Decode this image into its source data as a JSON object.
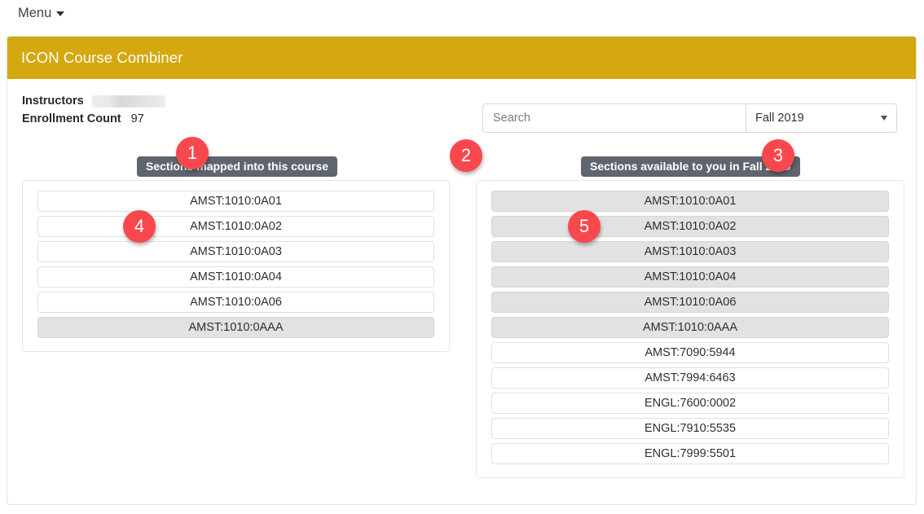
{
  "topbar": {
    "menu_label": "Menu",
    "caret_icon": "chevron-down-icon"
  },
  "card": {
    "header_title": "ICON Course Combiner"
  },
  "info": {
    "instructors_label": "Instructors",
    "instructors_value_redacted": "",
    "enrollment_label": "Enrollment Count",
    "enrollment_value": "97"
  },
  "search": {
    "placeholder": "Search",
    "value": ""
  },
  "term": {
    "selected": "Fall 2019",
    "options": [
      "Fall 2019"
    ],
    "caret_icon": "chevron-down-icon"
  },
  "panels": {
    "left": {
      "pill_label": "Sections mapped into this course",
      "items": [
        {
          "label": "AMST:1010:0A01",
          "state": "normal"
        },
        {
          "label": "AMST:1010:0A02",
          "state": "normal"
        },
        {
          "label": "AMST:1010:0A03",
          "state": "normal"
        },
        {
          "label": "AMST:1010:0A04",
          "state": "normal"
        },
        {
          "label": "AMST:1010:0A06",
          "state": "normal"
        },
        {
          "label": "AMST:1010:0AAA",
          "state": "muted"
        }
      ]
    },
    "right": {
      "pill_label": "Sections available to you in Fall 2019",
      "items": [
        {
          "label": "AMST:1010:0A01",
          "state": "muted"
        },
        {
          "label": "AMST:1010:0A02",
          "state": "muted"
        },
        {
          "label": "AMST:1010:0A03",
          "state": "muted"
        },
        {
          "label": "AMST:1010:0A04",
          "state": "muted"
        },
        {
          "label": "AMST:1010:0A06",
          "state": "muted"
        },
        {
          "label": "AMST:1010:0AAA",
          "state": "muted"
        },
        {
          "label": "AMST:7090:5944",
          "state": "normal"
        },
        {
          "label": "AMST:7994:6463",
          "state": "normal"
        },
        {
          "label": "ENGL:7600:0002",
          "state": "normal"
        },
        {
          "label": "ENGL:7910:5535",
          "state": "normal"
        },
        {
          "label": "ENGL:7999:5501",
          "state": "normal"
        }
      ]
    }
  },
  "badges": [
    {
      "number": "1"
    },
    {
      "number": "2"
    },
    {
      "number": "3"
    },
    {
      "number": "4"
    },
    {
      "number": "5"
    }
  ],
  "colors": {
    "header_bg": "#d4a80e",
    "badge_bg": "#f9484d",
    "pill_bg": "#5f656e",
    "item_muted_bg": "#e2e2e2"
  }
}
